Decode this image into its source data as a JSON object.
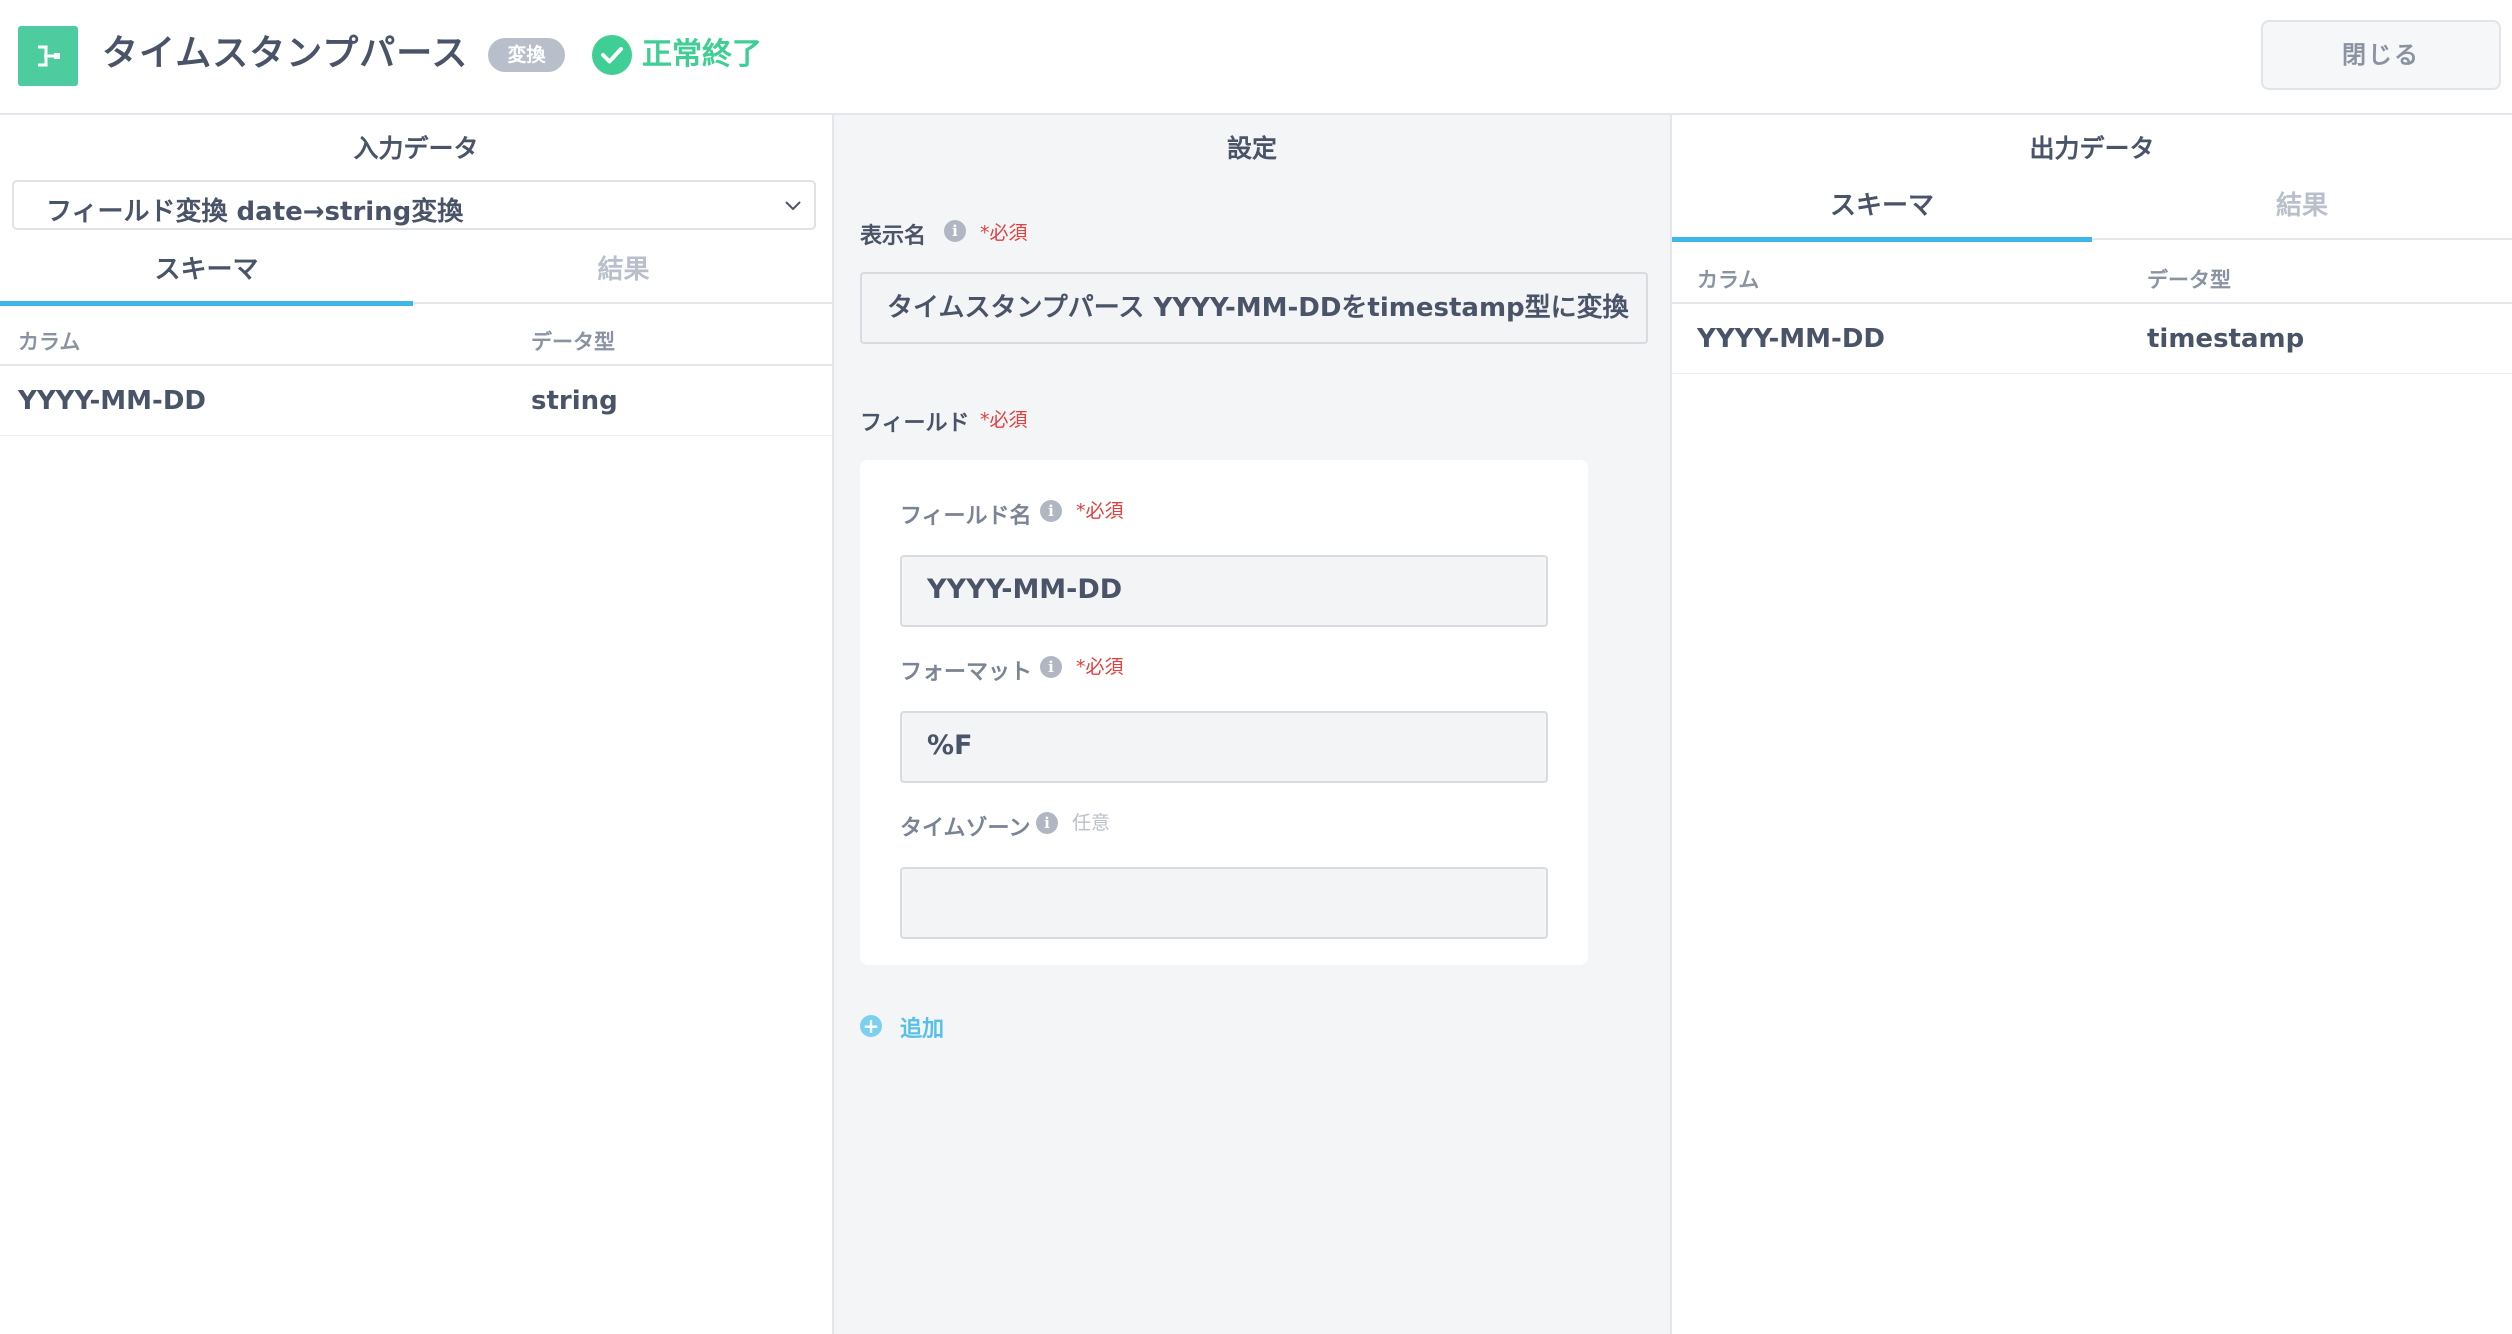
{
  "header": {
    "title": "タイムスタンプパース",
    "type_badge": "変換",
    "status": "正常終了",
    "close_label": "閉じる",
    "colors": {
      "node_icon": "#4ccc9f",
      "status": "#3fce93",
      "badge": "#b8bfcb"
    }
  },
  "input_panel": {
    "title": "入力データ",
    "source_select": "フィールド変換 date→string変換",
    "tabs": [
      {
        "label": "スキーマ",
        "active": true
      },
      {
        "label": "結果",
        "active": false
      }
    ],
    "columns": {
      "name": "カラム",
      "type": "データ型"
    },
    "rows": [
      {
        "name": "YYYY-MM-DD",
        "type": "string"
      }
    ]
  },
  "settings_panel": {
    "title": "設定",
    "display_name": {
      "label": "表示名",
      "required": "*必須",
      "value": "タイムスタンプパース YYYY-MM-DDをtimestamp型に変換"
    },
    "fields_section": {
      "label": "フィールド",
      "required": "*必須",
      "field_name": {
        "label": "フィールド名",
        "required": "*必須",
        "value": "YYYY-MM-DD"
      },
      "format": {
        "label": "フォーマット",
        "required": "*必須",
        "value": "%F"
      },
      "timezone": {
        "label": "タイムゾーン",
        "optional": "任意",
        "value": ""
      }
    },
    "add_label": "追加"
  },
  "output_panel": {
    "title": "出力データ",
    "tabs": [
      {
        "label": "スキーマ",
        "active": true
      },
      {
        "label": "結果",
        "active": false
      }
    ],
    "columns": {
      "name": "カラム",
      "type": "データ型"
    },
    "rows": [
      {
        "name": "YYYY-MM-DD",
        "type": "timestamp"
      }
    ]
  },
  "accent_color": "#3fb6e8",
  "required_color": "#e2403f"
}
